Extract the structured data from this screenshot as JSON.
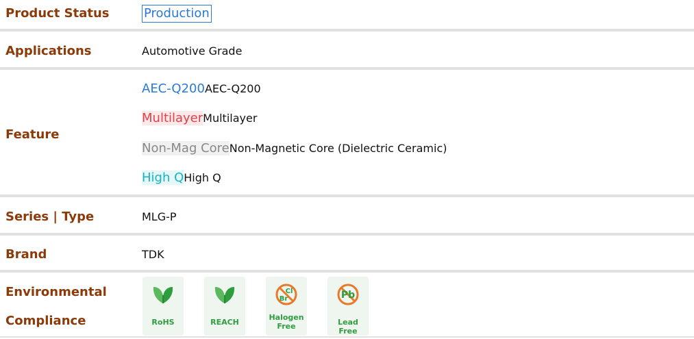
{
  "product_status": {
    "label": "Product Status",
    "value": "Production",
    "color": "#2979d8"
  },
  "applications": {
    "label": "Applications",
    "value": "Automotive Grade"
  },
  "feature": {
    "label": "Feature",
    "items": [
      {
        "tag": "AEC-Q200",
        "desc": "AEC-Q200",
        "color": "#2979d8",
        "bg": "#ffffff"
      },
      {
        "tag": "Multilayer",
        "desc": "Multilayer",
        "color": "#e0404a",
        "bg": "#fbe9ea"
      },
      {
        "tag": "Non-Mag Core",
        "desc": "Non-Magnetic Core (Dielectric Ceramic)",
        "color": "#888888",
        "bg": "#f1f1f1"
      },
      {
        "tag": "High Q",
        "desc": "High Q",
        "color": "#17b3c4",
        "bg": "#e6f7f8"
      }
    ]
  },
  "series_type": {
    "label": "Series | Type",
    "value": "MLG-P"
  },
  "brand": {
    "label": "Brand",
    "value": "TDK"
  },
  "environmental": {
    "label_line1": "Environmental",
    "label_line2": "Compliance",
    "items": [
      {
        "icon": "leaf-icon",
        "line1": "RoHS",
        "line2": ""
      },
      {
        "icon": "leaf-icon",
        "line1": "REACH",
        "line2": ""
      },
      {
        "icon": "halogen-free-icon",
        "line1": "Halogen",
        "line2": "Free",
        "icon_text_top": "Cl",
        "icon_text_bottom": "Br"
      },
      {
        "icon": "lead-free-icon",
        "line1": "Lead Free",
        "line2": "",
        "icon_text": "Pb"
      }
    ],
    "accent": "#2e9d3e",
    "icon_accent": "#e8782a"
  }
}
